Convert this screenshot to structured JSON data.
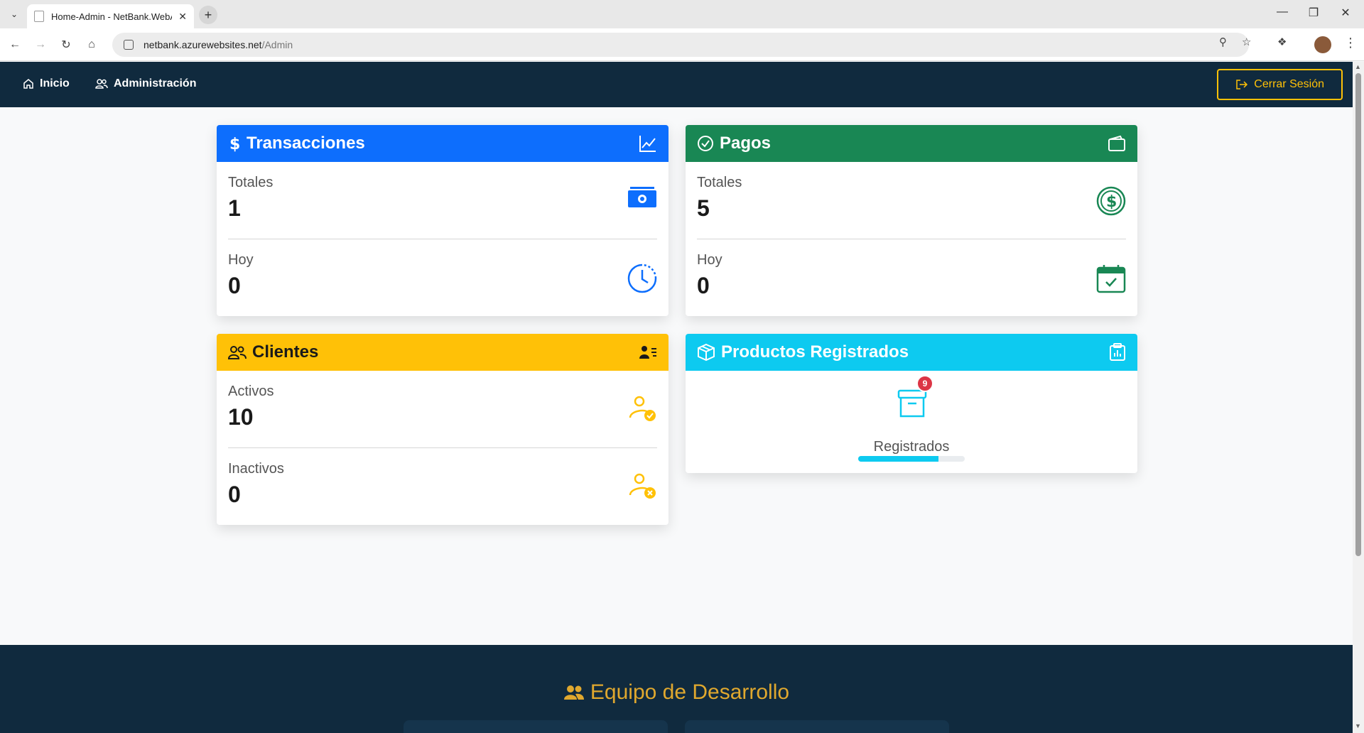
{
  "browser": {
    "tab_title": "Home-Admin - NetBank.WebApp",
    "url_domain": "netbank.azurewebsites.net",
    "url_path": "/Admin"
  },
  "nav": {
    "home_label": "Inicio",
    "admin_label": "Administración",
    "logout_label": "Cerrar Sesión"
  },
  "cards": {
    "transactions": {
      "title": "Transacciones",
      "color": "#0d6efd",
      "total_label": "Totales",
      "total_value": "1",
      "today_label": "Hoy",
      "today_value": "0"
    },
    "payments": {
      "title": "Pagos",
      "color": "#198754",
      "total_label": "Totales",
      "total_value": "5",
      "today_label": "Hoy",
      "today_value": "0"
    },
    "clients": {
      "title": "Clientes",
      "color": "#ffc107",
      "active_label": "Activos",
      "active_value": "10",
      "inactive_label": "Inactivos",
      "inactive_value": "0"
    },
    "products": {
      "title": "Productos Registrados",
      "color": "#0dcaf0",
      "badge": "9",
      "label": "Registrados",
      "progress_fraction": 0.75
    }
  },
  "footer": {
    "title": "Equipo de Desarrollo"
  }
}
